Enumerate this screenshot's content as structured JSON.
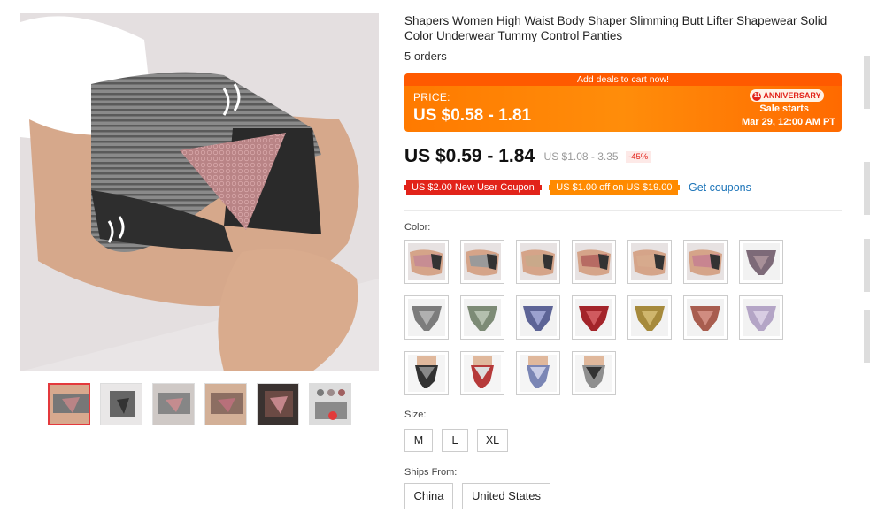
{
  "product": {
    "title": "Shapers Women High Waist Body Shaper Slimming Butt Lifter Shapewear Solid Color Underwear Tummy Control Panties",
    "orders": "5 orders"
  },
  "promo": {
    "banner": "Add deals to cart now!",
    "price_label": "PRICE:",
    "price": "US $0.58 - 1.81",
    "badge_num": "11",
    "badge": "ANNIVERSARY",
    "sale_starts": "Sale starts",
    "sale_date": "Mar 29, 12:00 AM PT",
    "colors": {
      "bg": "#ff8000",
      "badge_text": "#e2231a"
    }
  },
  "price": {
    "current": "US $0.59 - 1.84",
    "original": "US $1.08 - 3.35",
    "discount": "-45%"
  },
  "coupons": {
    "new_user": "US $2.00 New User Coupon",
    "store": "US $1.00 off on US $19.00",
    "get": "Get coupons"
  },
  "color": {
    "label": "Color:",
    "swatches": [
      {
        "name": "pink-side",
        "color": "#c78d93"
      },
      {
        "name": "gray-side",
        "color": "#9a9a9a"
      },
      {
        "name": "beige-side",
        "color": "#c9a98a"
      },
      {
        "name": "red-side",
        "color": "#b76b63"
      },
      {
        "name": "nude-side",
        "color": "#d7aa8d"
      },
      {
        "name": "rose-side",
        "color": "#c88590"
      },
      {
        "name": "purple-flat",
        "color": "#7d6a78"
      },
      {
        "name": "gray-flat",
        "color": "#7c7c7c"
      },
      {
        "name": "green-flat",
        "color": "#7d8b76"
      },
      {
        "name": "blue-flat",
        "color": "#5d6496"
      },
      {
        "name": "red-flat",
        "color": "#a3242a"
      },
      {
        "name": "khaki-flat",
        "color": "#a68a3c"
      },
      {
        "name": "brick-flat",
        "color": "#a85d4f"
      },
      {
        "name": "lilac-flat",
        "color": "#b4a5c6"
      },
      {
        "name": "black-model",
        "color": "#333333"
      },
      {
        "name": "red-model",
        "color": "#b63a3a"
      },
      {
        "name": "blue-model",
        "color": "#7b86b5"
      },
      {
        "name": "gray-model",
        "color": "#8f8f8f"
      }
    ]
  },
  "size": {
    "label": "Size:",
    "options": [
      "M",
      "L",
      "XL"
    ]
  },
  "ships_from": {
    "label": "Ships From:",
    "options": [
      "China",
      "United States"
    ]
  }
}
